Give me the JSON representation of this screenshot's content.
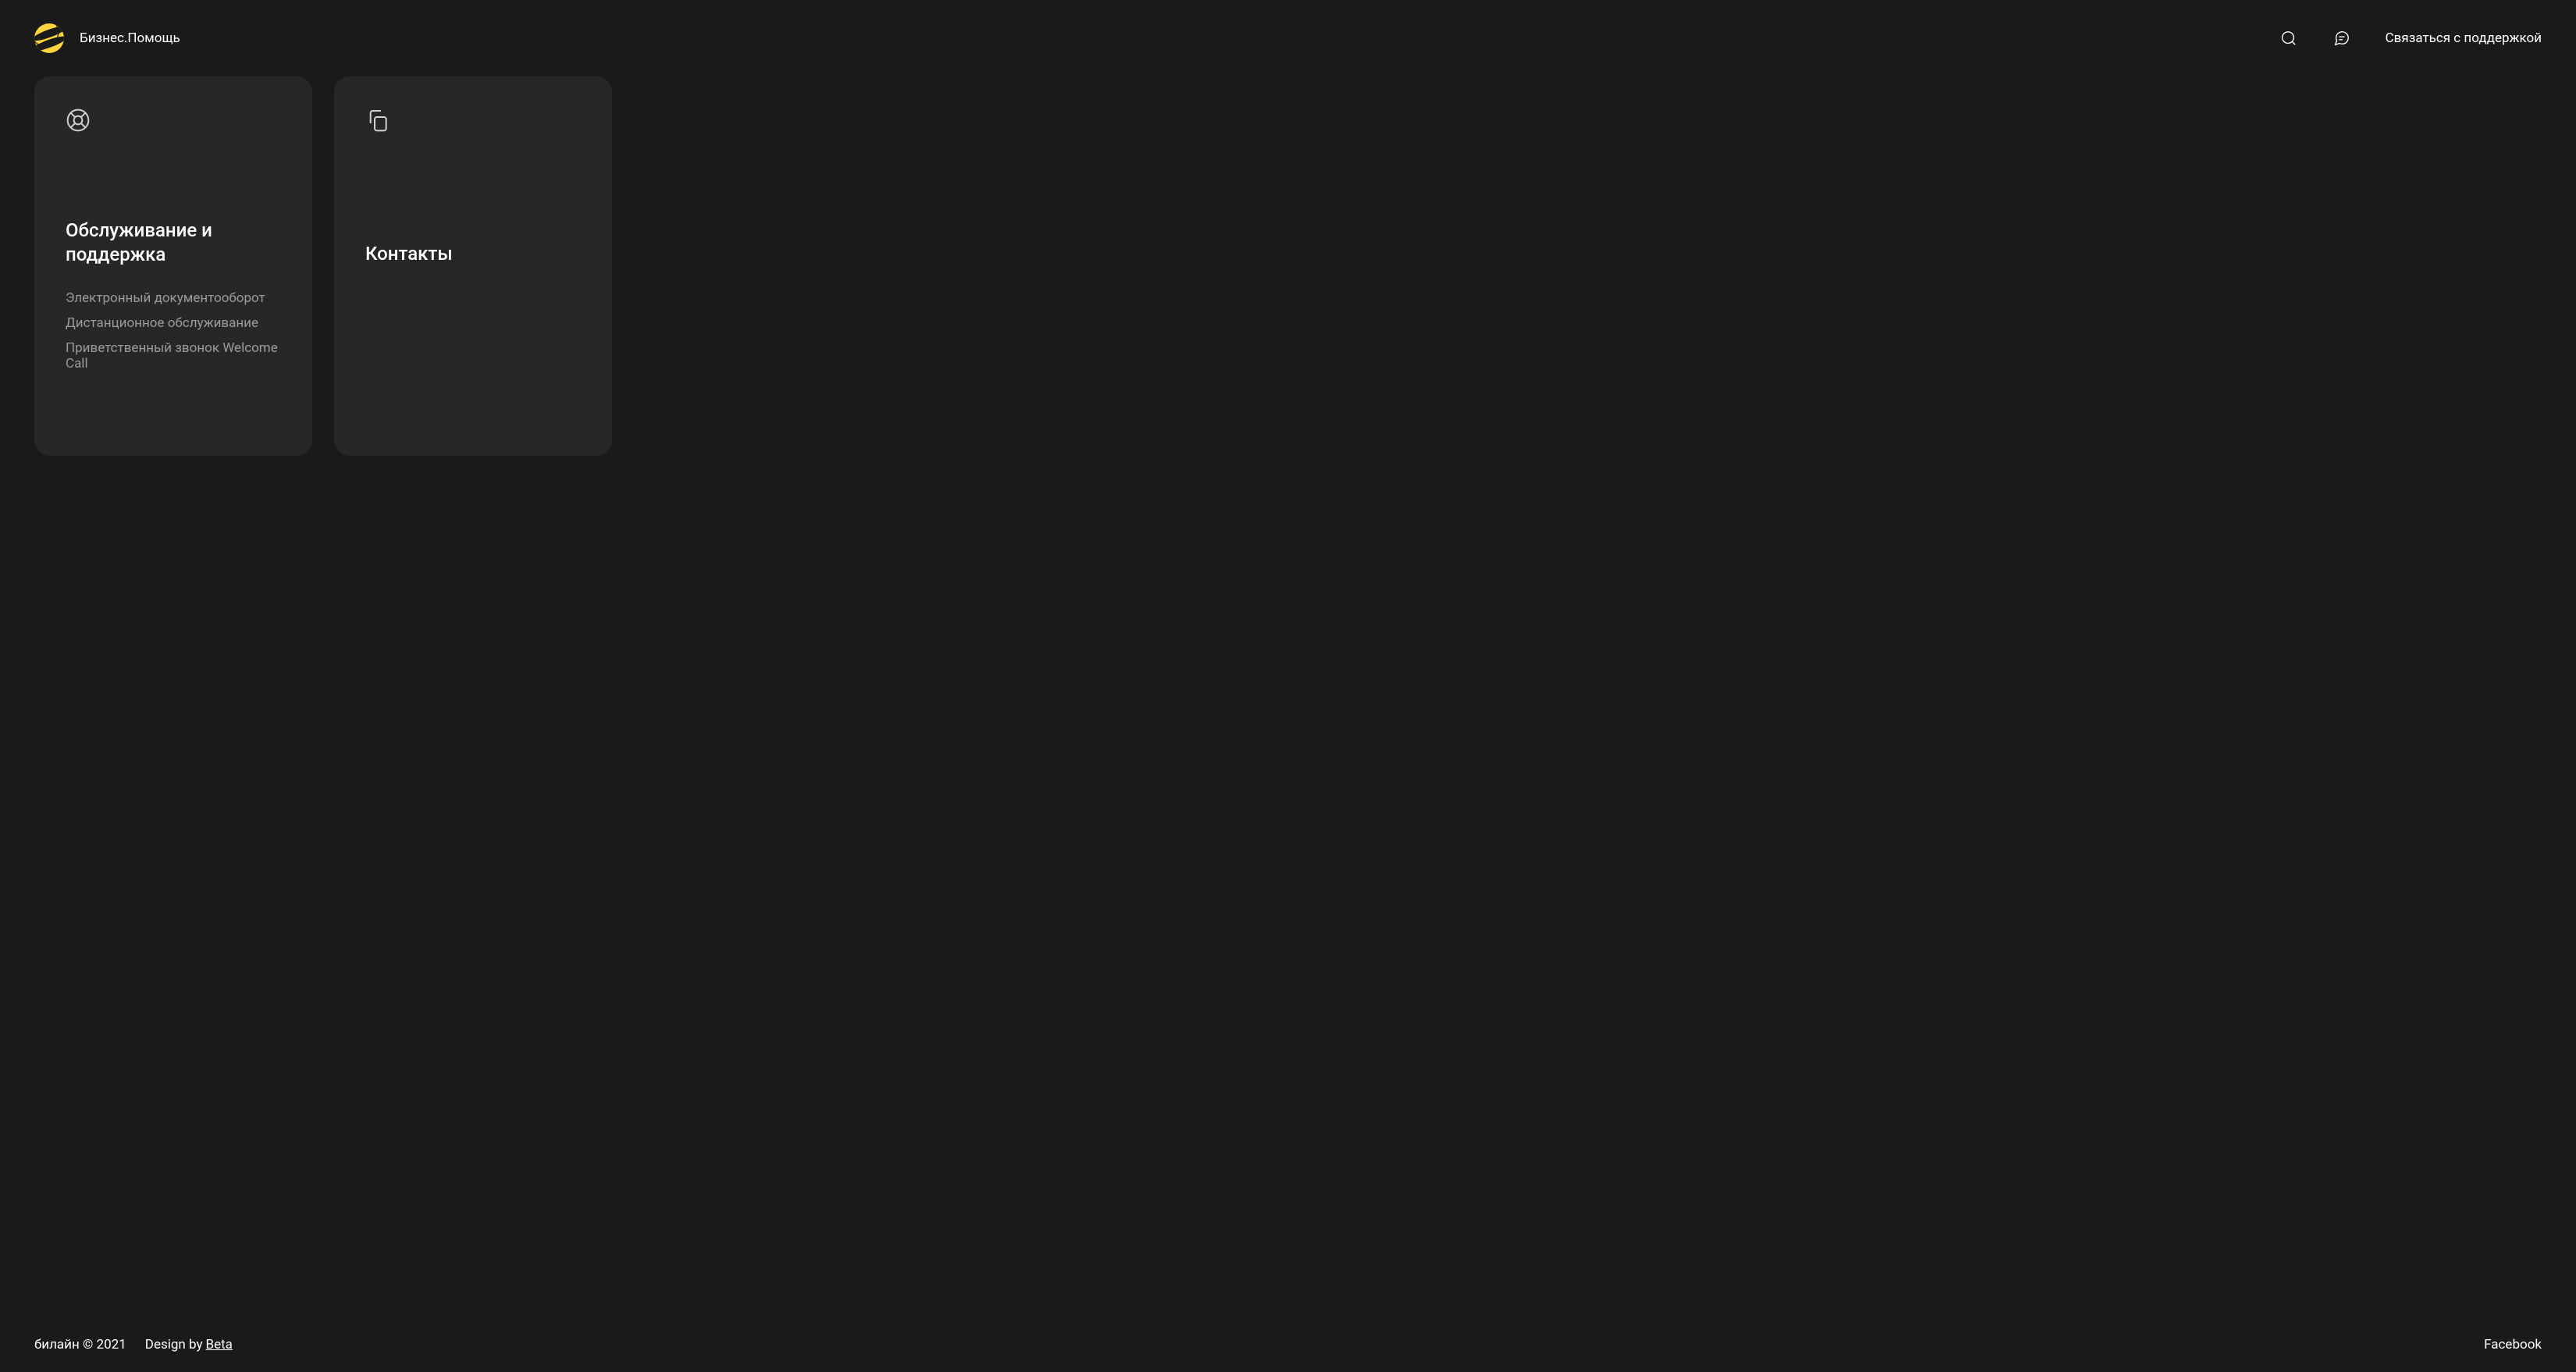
{
  "header": {
    "brand": "Бизнес.Помощь",
    "support_link": "Связаться с поддержкой"
  },
  "main": {
    "cards": [
      {
        "title": "Обслуживание и поддержка",
        "links": [
          "Электронный документооборот",
          "Дистанционное обслуживание",
          "Приветственный звонок Welcome Call"
        ]
      },
      {
        "title": "Контакты",
        "links": []
      }
    ]
  },
  "footer": {
    "copyright": "билайн © 2021",
    "design_prefix": "Design by",
    "design_link": "Beta",
    "social": "Facebook"
  }
}
